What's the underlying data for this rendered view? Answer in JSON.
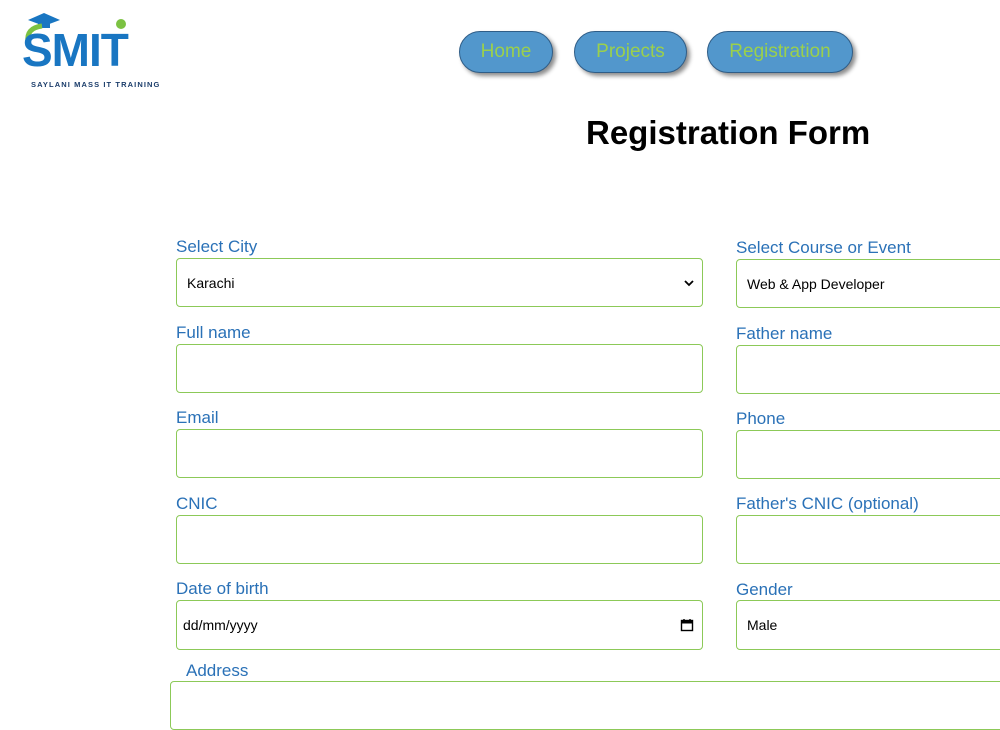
{
  "logo": {
    "text": "SMIT",
    "tagline": "SAYLANI MASS IT TRAINING"
  },
  "nav": {
    "home": "Home",
    "projects": "Projects",
    "registration": "Registration"
  },
  "title": "Registration Form",
  "form": {
    "city": {
      "label": "Select City",
      "value": "Karachi"
    },
    "course": {
      "label": "Select Course or Event",
      "value": "Web & App Developer"
    },
    "full_name": {
      "label": "Full name",
      "value": ""
    },
    "father_name": {
      "label": "Father name",
      "value": ""
    },
    "email": {
      "label": "Email",
      "value": ""
    },
    "phone": {
      "label": "Phone",
      "value": ""
    },
    "cnic": {
      "label": "CNIC",
      "value": ""
    },
    "father_cnic": {
      "label": "Father's CNIC (optional)",
      "value": ""
    },
    "dob": {
      "label": "Date of birth",
      "placeholder": "dd/mm/yyyy"
    },
    "gender": {
      "label": "Gender",
      "value": "Male"
    },
    "address": {
      "label": "Address",
      "value": ""
    }
  },
  "colors": {
    "nav_bg": "#5297cc",
    "nav_text": "#9bd04c",
    "label": "#2a71b7",
    "border": "#8cc958"
  }
}
